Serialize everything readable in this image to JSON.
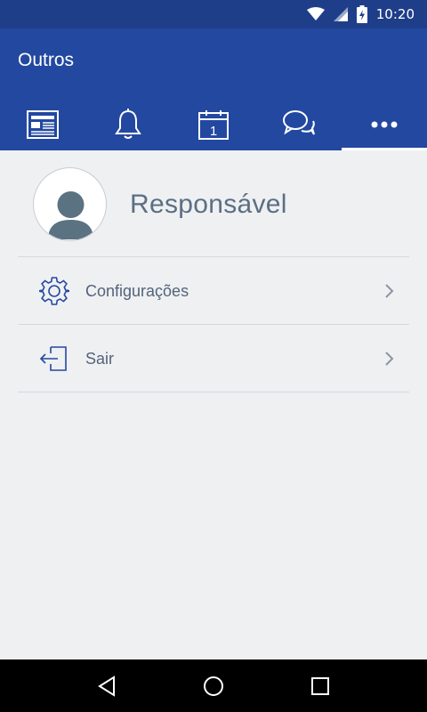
{
  "status_bar": {
    "time": "10:20",
    "icons": [
      "wifi-icon",
      "signal-icon",
      "battery-charging-icon"
    ]
  },
  "app_bar": {
    "title": "Outros"
  },
  "tabs": [
    {
      "name": "news",
      "icon": "newspaper-icon",
      "active": false
    },
    {
      "name": "notifications",
      "icon": "bell-icon",
      "active": false
    },
    {
      "name": "calendar",
      "icon": "calendar-icon",
      "calendar_day": "1",
      "active": false
    },
    {
      "name": "messages",
      "icon": "chat-icon",
      "active": false
    },
    {
      "name": "more",
      "icon": "more-icon",
      "active": true
    }
  ],
  "profile": {
    "name": "Responsável",
    "avatar_icon": "user-avatar-icon"
  },
  "menu": [
    {
      "label": "Configurações",
      "icon": "gear-icon"
    },
    {
      "label": "Sair",
      "icon": "logout-icon"
    }
  ],
  "nav_bar": {
    "buttons": [
      "back-icon",
      "home-icon",
      "recents-icon"
    ]
  },
  "colors": {
    "status_bar": "#1f3e8a",
    "app_bar": "#2348a0",
    "background": "#eff0f2",
    "icon_accent": "#2348a0",
    "text": "#52647a"
  }
}
